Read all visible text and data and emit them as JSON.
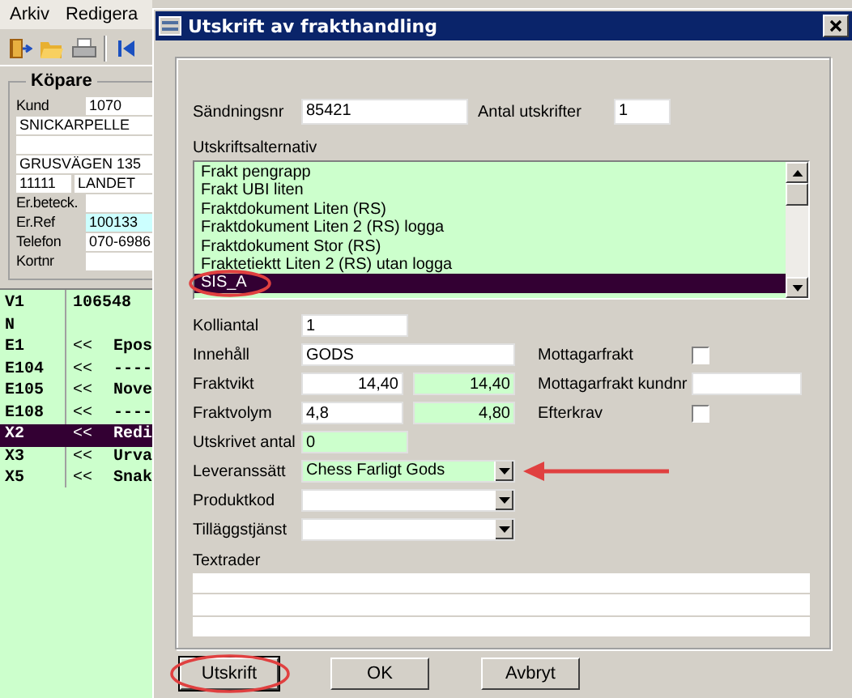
{
  "main_window": {
    "menu": [
      {
        "label": "Arkiv"
      },
      {
        "label": "Redigera"
      }
    ],
    "buyer": {
      "title": "Köpare",
      "rows": [
        {
          "kind": "labeled",
          "label": "Kund",
          "value": "1070",
          "highlighted": false
        },
        {
          "kind": "line",
          "value": "SNICKARPELLE",
          "highlighted": false
        },
        {
          "kind": "line",
          "highlighted": false
        },
        {
          "kind": "line",
          "value": "GRUSVÄGEN 135",
          "highlighted": false
        },
        {
          "kind": "split",
          "value": "11111",
          "value_2": "LANDET",
          "highlighted": false
        },
        {
          "kind": "labeled",
          "label": "Er.beteck.",
          "highlighted": false
        },
        {
          "kind": "labeled",
          "label": "Er.Ref",
          "value": "100133",
          "highlighted": true
        },
        {
          "kind": "labeled",
          "label": "Telefon",
          "value": "070-6986",
          "highlighted": false
        },
        {
          "kind": "labeled",
          "label": "Kortnr",
          "highlighted": false
        }
      ]
    },
    "list": [
      {
        "code": "V1",
        "column_2": "106548",
        "selected": false
      },
      {
        "code": "N",
        "selected": false
      },
      {
        "code": "E1",
        "column_2": "<<",
        "column_3": "Epos",
        "selected": false
      },
      {
        "code": "E104",
        "column_2": "<<",
        "column_3": "----",
        "selected": false
      },
      {
        "code": "E105",
        "column_2": "<<",
        "column_3": "Nove",
        "selected": false
      },
      {
        "code": "E108",
        "column_2": "<<",
        "column_3": "----",
        "selected": false
      },
      {
        "code": "X2",
        "column_2": "<<",
        "column_3": "Redi",
        "selected": true
      },
      {
        "code": "X3",
        "column_2": "<<",
        "column_3": "Urva",
        "selected": false
      },
      {
        "code": "X5",
        "column_2": "<<",
        "column_3": "Snak",
        "selected": false
      }
    ]
  },
  "dialog": {
    "title": "Utskrift av frakthandling",
    "shipment_no": {
      "label": "Sändningsnr",
      "value": "85421"
    },
    "copies": {
      "label": "Antal utskrifter",
      "value": "1"
    },
    "print_options": {
      "label": "Utskriftsalternativ",
      "items": [
        {
          "text": "Frakt pengrapp",
          "selected": false,
          "annotated": false
        },
        {
          "text": "Frakt UBI liten",
          "selected": false,
          "annotated": false
        },
        {
          "text": "Fraktdokument Liten (RS)",
          "selected": false,
          "annotated": false
        },
        {
          "text": "Fraktdokument Liten 2 (RS) logga",
          "selected": false,
          "annotated": false
        },
        {
          "text": "Fraktdokument Stor (RS)",
          "selected": false,
          "annotated": false
        },
        {
          "text": "Fraktetiektt Liten 2 (RS) utan logga",
          "selected": false,
          "annotated": false
        },
        {
          "text": "SIS_A",
          "selected": true,
          "annotated": true
        }
      ]
    },
    "rows": [
      {
        "kind": "short",
        "label": "Kolliantal",
        "annotated": false,
        "fields": [
          {
            "value": "1",
            "readonly": false
          }
        ]
      },
      {
        "kind": "wide",
        "label": "Innehåll",
        "annotated": false,
        "fields": [
          {
            "value": "GODS",
            "readonly": false
          }
        ],
        "side": {
          "kind": "checkbox",
          "label": "Mottagarfrakt",
          "checked": false
        }
      },
      {
        "kind": "pair",
        "label": "Fraktvikt",
        "annotated": false,
        "fields": [
          {
            "value": "14,40",
            "readonly": false
          },
          {
            "value": "14,40",
            "readonly": true
          }
        ],
        "side": {
          "kind": "field",
          "label": "Mottagarfrakt kundnr"
        }
      },
      {
        "kind": "pair",
        "label": "Fraktvolym",
        "annotated": false,
        "fields": [
          {
            "value": "4,8",
            "readonly": false
          },
          {
            "value": "4,80",
            "readonly": true
          }
        ],
        "side": {
          "kind": "checkbox",
          "label": "Efterkrav",
          "checked": false
        }
      },
      {
        "kind": "short",
        "label": "Utskrivet antal",
        "annotated": false,
        "fields": [
          {
            "value": "0",
            "readonly": true
          }
        ]
      },
      {
        "kind": "combo",
        "label": "Leveranssätt",
        "annotated": true,
        "fields": [
          {
            "value": "Chess Farligt Gods",
            "readonly": true
          }
        ]
      },
      {
        "kind": "combo",
        "label": "Produktkod",
        "annotated": false,
        "fields": [
          {
            "readonly": false
          }
        ]
      },
      {
        "kind": "combo",
        "label": "Tilläggstjänst",
        "annotated": false,
        "fields": [
          {
            "readonly": false
          }
        ]
      }
    ],
    "text_lines": {
      "label": "Textrader",
      "lines": [
        {
          "readonly": false
        },
        {
          "readonly": false
        },
        {
          "readonly": false
        }
      ]
    },
    "buttons": [
      {
        "label": "Utskrift",
        "annotated": true
      },
      {
        "label": "OK",
        "annotated": false
      },
      {
        "label": "Avbryt",
        "annotated": false
      }
    ]
  }
}
